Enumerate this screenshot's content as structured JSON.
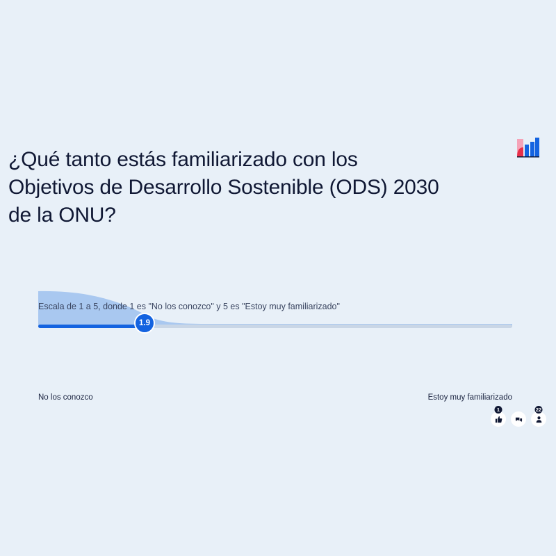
{
  "question": {
    "line1": "¿Qué tanto estás familiarizado con los",
    "line2": "Objetivos de Desarrollo Sostenible (ODS) 2030",
    "line3": "de la ONU?"
  },
  "scale": {
    "description": "Escala de 1 a 5, donde 1 es \"No los conozco\" y 5 es \"Estoy muy familiarizado\"",
    "min": 1,
    "max": 5,
    "current_value": 1.9,
    "current_label": "1.9",
    "min_label": "No los conozco",
    "max_label": "Estoy muy familiarizado"
  },
  "footer": {
    "reactions_count": "1",
    "participants_count": "22",
    "icons": [
      "thumbs-up-icon",
      "chat-icon",
      "person-icon"
    ]
  },
  "colors": {
    "background": "#e8f0f8",
    "accent": "#1463e0",
    "distribution": "#a9c8f0",
    "track": "#c9d6e6",
    "text": "#101834",
    "logo_pink": "#f5a3b8",
    "logo_red": "#e8304a",
    "logo_blue": "#1463e0"
  }
}
